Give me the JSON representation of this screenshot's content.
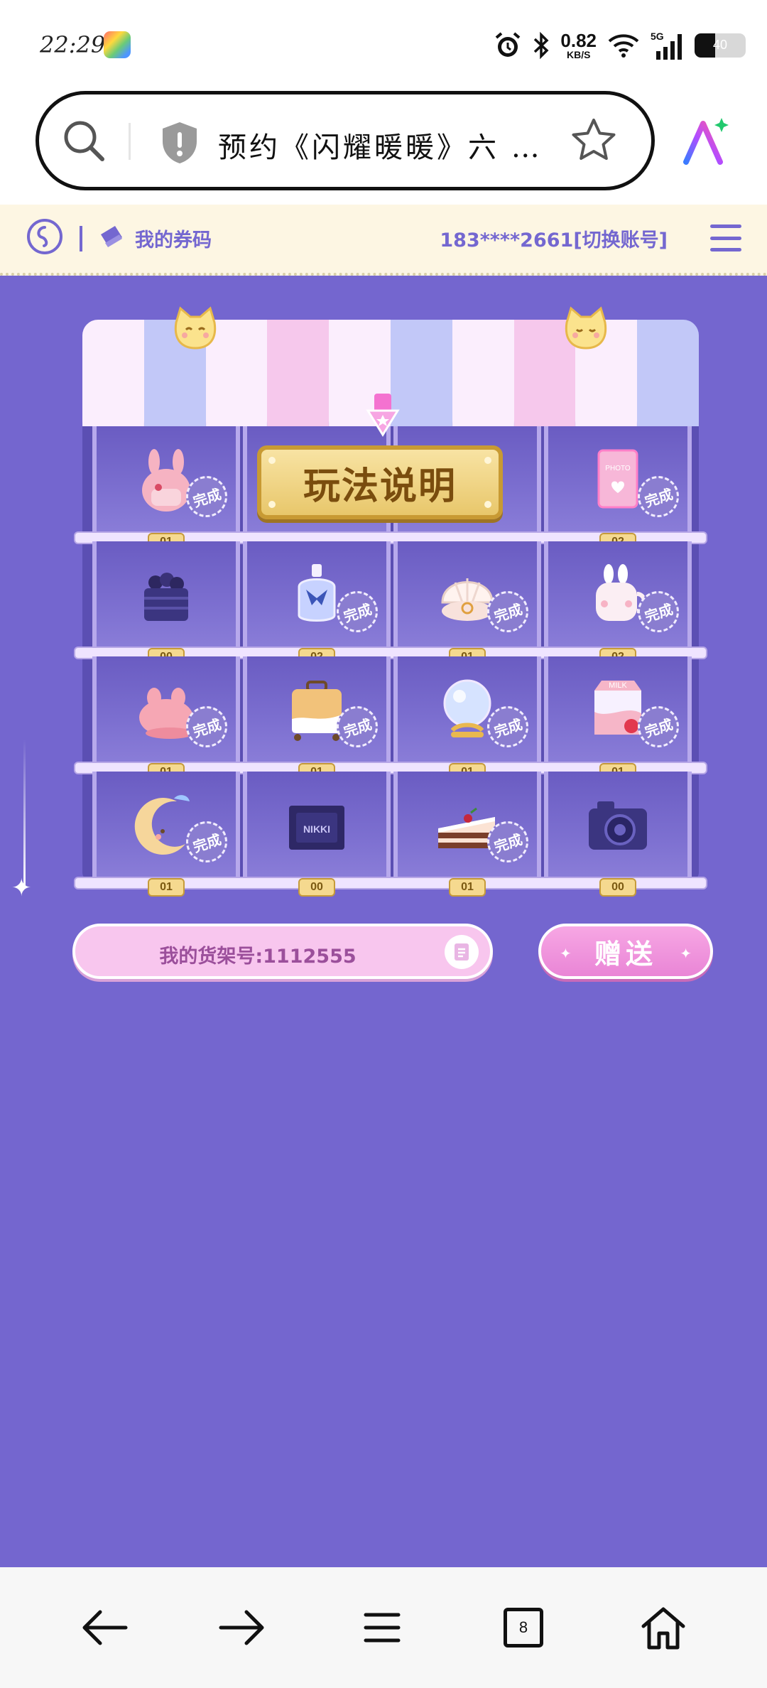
{
  "status_bar": {
    "time": "22:29",
    "net_speed_value": "0.82",
    "net_speed_unit": "KB/S",
    "network": "5G",
    "battery_level": "40",
    "battery_fraction": 0.4
  },
  "address_bar": {
    "url_text": "预约《闪耀暖暖》六 …"
  },
  "site_header": {
    "my_codes_label": "我的券码",
    "account_text": "183****2661[切换账号]"
  },
  "shop": {
    "howto_label": "玩法说明",
    "complete_label": "完成",
    "rows": [
      [
        {
          "name": "rabbit-backpack",
          "count": "01",
          "complete": true
        },
        {
          "name": "howto-sign",
          "count": "",
          "complete": false
        },
        {
          "name": "howto-sign",
          "count": "",
          "complete": false
        },
        {
          "name": "photo-album",
          "count": "02",
          "complete": true
        }
      ],
      [
        {
          "name": "berry-basket",
          "count": "00",
          "complete": false
        },
        {
          "name": "perfume-bottle",
          "count": "02",
          "complete": true
        },
        {
          "name": "shell-ring",
          "count": "01",
          "complete": true
        },
        {
          "name": "bunny-mug",
          "count": "02",
          "complete": true
        }
      ],
      [
        {
          "name": "pink-beret",
          "count": "01",
          "complete": true
        },
        {
          "name": "suitcase",
          "count": "01",
          "complete": true
        },
        {
          "name": "crystal-ball",
          "count": "01",
          "complete": true
        },
        {
          "name": "milk-carton",
          "count": "01",
          "complete": true
        }
      ],
      [
        {
          "name": "moon-pillow",
          "count": "01",
          "complete": true
        },
        {
          "name": "nikki-box",
          "count": "00",
          "complete": false
        },
        {
          "name": "layer-cake",
          "count": "01",
          "complete": true
        },
        {
          "name": "camera",
          "count": "00",
          "complete": false
        }
      ]
    ]
  },
  "shelf": {
    "label": "我的货架号:1112555"
  },
  "gift_button": {
    "label": "赠送"
  },
  "nav": {
    "tabs_count": "8"
  },
  "colors": {
    "page_bg": "#7466cf",
    "accent": "#7467d0",
    "header_bg": "#fdf6e3",
    "pink_button": "#f0a0de"
  }
}
